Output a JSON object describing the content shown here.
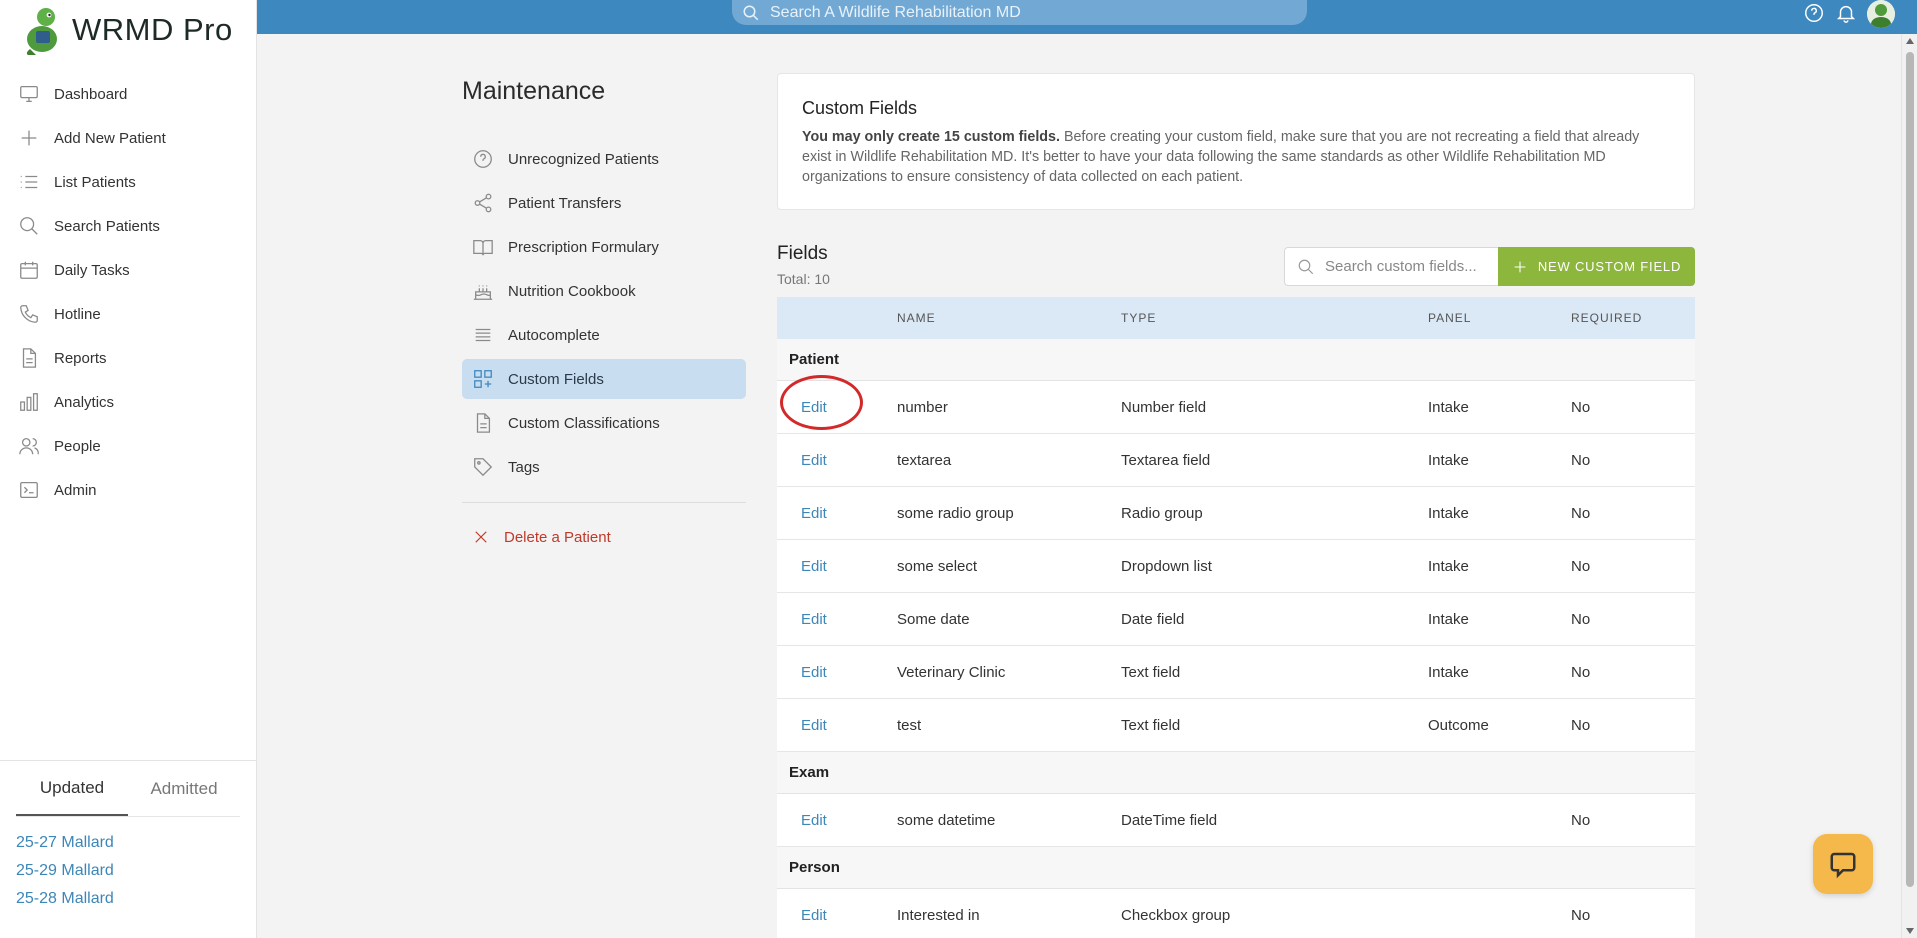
{
  "app": {
    "title": "WRMD Pro"
  },
  "global_search": {
    "placeholder": "Search A Wildlife Rehabilitation MD"
  },
  "sidebar": {
    "items": [
      {
        "label": "Dashboard",
        "icon": "monitor-icon"
      },
      {
        "label": "Add New Patient",
        "icon": "plus-icon"
      },
      {
        "label": "List Patients",
        "icon": "list-icon"
      },
      {
        "label": "Search Patients",
        "icon": "search-icon"
      },
      {
        "label": "Daily Tasks",
        "icon": "calendar-icon"
      },
      {
        "label": "Hotline",
        "icon": "phone-icon"
      },
      {
        "label": "Reports",
        "icon": "document-icon"
      },
      {
        "label": "Analytics",
        "icon": "bar-chart-icon"
      },
      {
        "label": "People",
        "icon": "users-icon"
      },
      {
        "label": "Admin",
        "icon": "terminal-icon"
      }
    ],
    "recent": {
      "tabs": [
        "Updated",
        "Admitted"
      ],
      "active_tab": "Updated",
      "patients": [
        "25-27 Mallard",
        "25-29 Mallard",
        "25-28 Mallard"
      ]
    }
  },
  "maintenance": {
    "title": "Maintenance",
    "menu": [
      {
        "label": "Unrecognized Patients",
        "icon": "question-circle-icon"
      },
      {
        "label": "Patient Transfers",
        "icon": "share-icon"
      },
      {
        "label": "Prescription Formulary",
        "icon": "book-open-icon"
      },
      {
        "label": "Nutrition Cookbook",
        "icon": "cake-icon"
      },
      {
        "label": "Autocomplete",
        "icon": "menu-lines-icon"
      },
      {
        "label": "Custom Fields",
        "icon": "grid-plus-icon",
        "active": true
      },
      {
        "label": "Custom Classifications",
        "icon": "document-icon"
      },
      {
        "label": "Tags",
        "icon": "tag-icon"
      }
    ],
    "delete_label": "Delete a Patient"
  },
  "info": {
    "title": "Custom Fields",
    "bold": "You may only create 15 custom fields.",
    "text": " Before creating your custom field, make sure that you are not recreating a field that already exist in Wildlife Rehabilitation MD. It's better to have your data following the same standards as other Wildlife Rehabilitation MD organizations to ensure consistency of data collected on each patient."
  },
  "fields": {
    "title": "Fields",
    "total": "Total: 10",
    "search_placeholder": "Search custom fields...",
    "new_button": "NEW CUSTOM FIELD",
    "columns": [
      "NAME",
      "TYPE",
      "PANEL",
      "REQUIRED"
    ],
    "edit_label": "Edit",
    "groups": [
      {
        "name": "Patient",
        "rows": [
          {
            "name": "number",
            "type": "Number field",
            "panel": "Intake",
            "required": "No"
          },
          {
            "name": "textarea",
            "type": "Textarea field",
            "panel": "Intake",
            "required": "No"
          },
          {
            "name": "some radio group",
            "type": "Radio group",
            "panel": "Intake",
            "required": "No"
          },
          {
            "name": "some select",
            "type": "Dropdown list",
            "panel": "Intake",
            "required": "No"
          },
          {
            "name": "Some date",
            "type": "Date field",
            "panel": "Intake",
            "required": "No"
          },
          {
            "name": "Veterinary Clinic",
            "type": "Text field",
            "panel": "Intake",
            "required": "No"
          },
          {
            "name": "test",
            "type": "Text field",
            "panel": "Outcome",
            "required": "No"
          }
        ]
      },
      {
        "name": "Exam",
        "rows": [
          {
            "name": "some datetime",
            "type": "DateTime field",
            "panel": "",
            "required": "No"
          }
        ]
      },
      {
        "name": "Person",
        "rows": [
          {
            "name": "Interested in",
            "type": "Checkbox group",
            "panel": "",
            "required": "No"
          }
        ]
      }
    ]
  },
  "colors": {
    "topbar": "#3e88c0",
    "accent_green": "#8cb63c",
    "link": "#3d86b8",
    "danger": "#c0392b",
    "annotation": "#d22a2a"
  }
}
